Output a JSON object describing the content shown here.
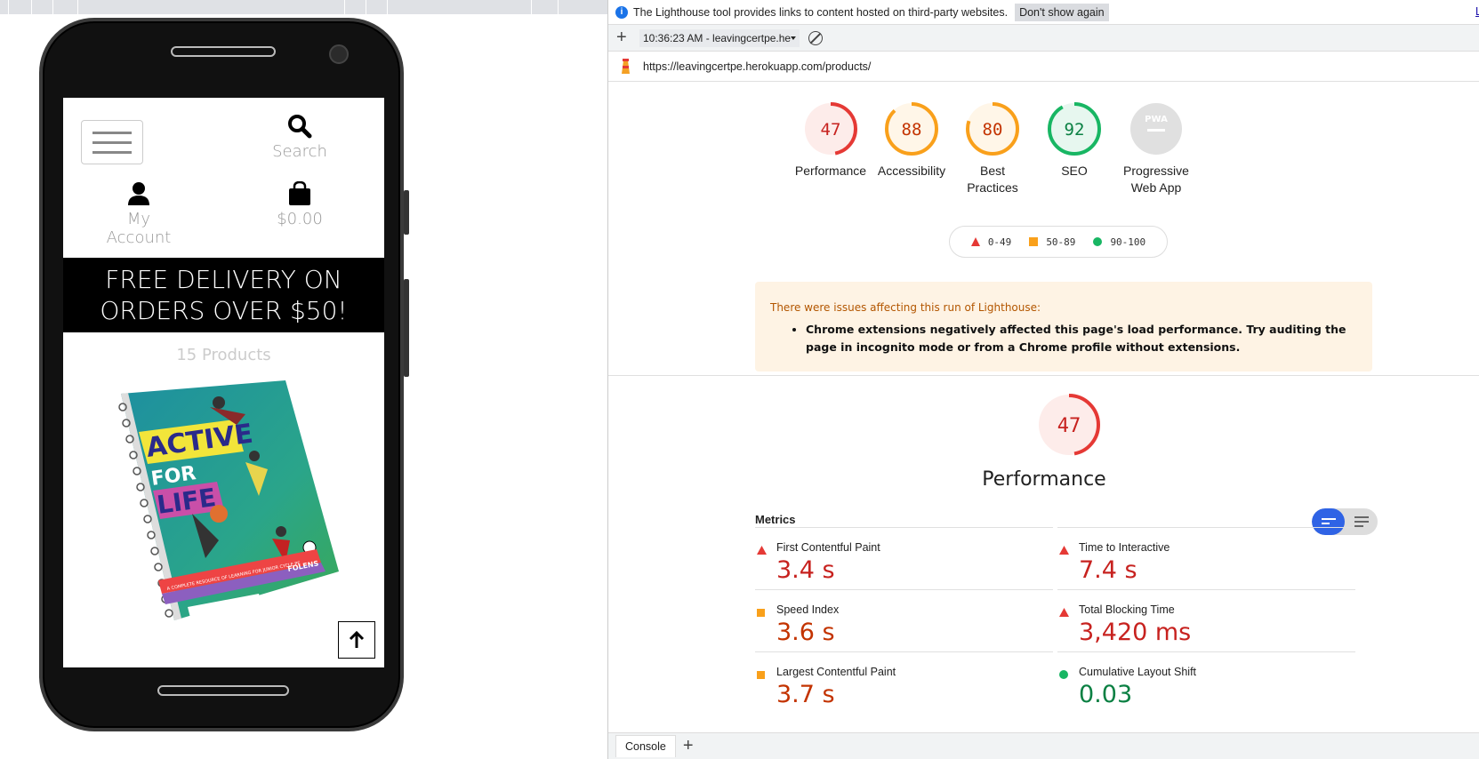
{
  "device": {
    "nav": {
      "search_label": "Search",
      "account_label": "My Account",
      "bag_label": "$0.00"
    },
    "banner": {
      "line1": "FREE DELIVERY ON",
      "line2": "ORDERS OVER $50!"
    },
    "product_count": "15 Products",
    "book": {
      "title_line1": "ACTIVE",
      "title_line2": "FOR",
      "title_line3": "LIFE",
      "tagline": "A COMPLETE RESOURCE OF LEARNING FOR JUNIOR CYCLE PE",
      "publisher": "FOLENS"
    }
  },
  "devtools": {
    "infobar": {
      "message": "The Lighthouse tool provides links to content hosted on third-party websites.",
      "dont_show": "Don't show again",
      "learn": "L"
    },
    "toolbar": {
      "report_select": "10:36:23 AM - leavingcertpe.he"
    },
    "url": "https://leavingcertpe.herokuapp.com/products/",
    "scores": [
      {
        "value": "47",
        "label": "Performance",
        "fraction": 0.47,
        "color": "#e53935",
        "bg": "#fdecea"
      },
      {
        "value": "88",
        "label": "Accessibility",
        "fraction": 0.88,
        "color": "#f9a01b",
        "bg": "#fff6e8"
      },
      {
        "value": "80",
        "label": "Best Practices",
        "fraction": 0.8,
        "color": "#f9a01b",
        "bg": "#fff6e8"
      },
      {
        "value": "92",
        "label": "SEO",
        "fraction": 0.92,
        "color": "#18b663",
        "bg": "#e7f7ef"
      },
      {
        "value": "PWA",
        "label": "Progressive Web App",
        "fraction": 0,
        "color": "#d0d0d0",
        "bg": "#e0e0e0"
      }
    ],
    "legend": [
      {
        "range": "0-49",
        "shape": "triangle",
        "color": "#e53935"
      },
      {
        "range": "50-89",
        "shape": "square",
        "color": "#f9a01b"
      },
      {
        "range": "90-100",
        "shape": "circle",
        "color": "#18b663"
      }
    ],
    "warning": {
      "title": "There were issues affecting this run of Lighthouse:",
      "item": "Chrome extensions negatively affected this page's load performance. Try auditing the page in incognito mode or from a Chrome profile without extensions."
    },
    "performance": {
      "value": "47",
      "fraction": 0.47,
      "title": "Performance"
    },
    "metrics_title": "Metrics",
    "metrics": [
      {
        "name": "First Contentful Paint",
        "value": "3.4 s",
        "status": "fail",
        "color": "#c7221f"
      },
      {
        "name": "Time to Interactive",
        "value": "7.4 s",
        "status": "fail",
        "color": "#c7221f"
      },
      {
        "name": "Speed Index",
        "value": "3.6 s",
        "status": "average",
        "color": "#c33300"
      },
      {
        "name": "Total Blocking Time",
        "value": "3,420 ms",
        "status": "fail",
        "color": "#c7221f"
      },
      {
        "name": "Largest Contentful Paint",
        "value": "3.7 s",
        "status": "average",
        "color": "#c33300"
      },
      {
        "name": "Cumulative Layout Shift",
        "value": "0.03",
        "status": "pass",
        "color": "#0b8043"
      }
    ],
    "bottom": {
      "tab": "Console"
    }
  }
}
